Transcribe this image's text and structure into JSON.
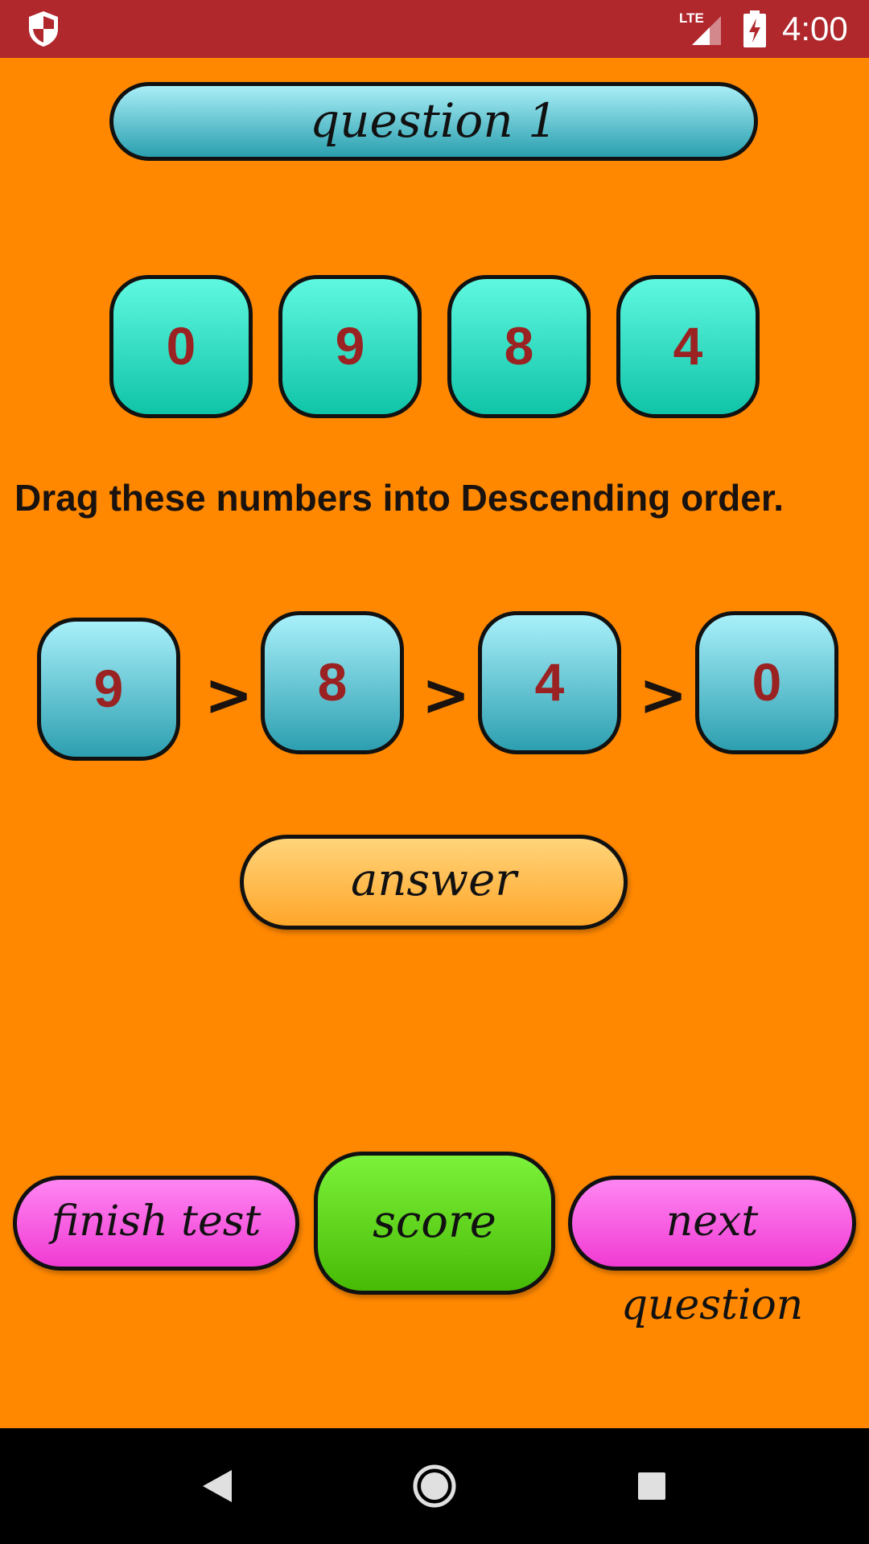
{
  "status_bar": {
    "time": "4:00",
    "network_label": "LTE"
  },
  "question": {
    "title": "question 1",
    "instruction": "Drag these numbers into Descending order."
  },
  "source_tiles": [
    "0",
    "9",
    "8",
    "4"
  ],
  "answer_tiles": [
    "9",
    "8",
    "4",
    "0"
  ],
  "comparators": [
    ">",
    ">",
    ">"
  ],
  "buttons": {
    "answer": "answer",
    "finish": "finish test",
    "score": "score",
    "next": "next question"
  },
  "colors": {
    "background": "#FF8800",
    "status_bar": "#B0272C",
    "tile_number": "#9B2222",
    "pink_button": "#F03BD3",
    "score_button": "#47BA05"
  }
}
